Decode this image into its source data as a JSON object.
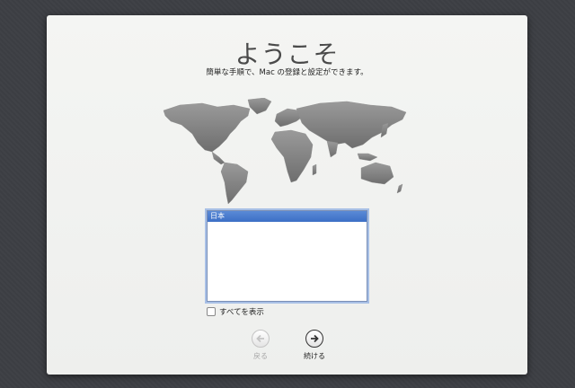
{
  "welcome": {
    "title": "ようこそ",
    "subtitle": "簡単な手順で、Mac の登録と設定ができます。"
  },
  "country_list": {
    "items": [
      "日本"
    ],
    "selected": "日本"
  },
  "show_all": {
    "label": "すべてを表示",
    "checked": false
  },
  "nav": {
    "back_label": "戻る",
    "continue_label": "続ける"
  },
  "colors": {
    "selection": "#3c6fc6",
    "background": "#3d3f44"
  }
}
